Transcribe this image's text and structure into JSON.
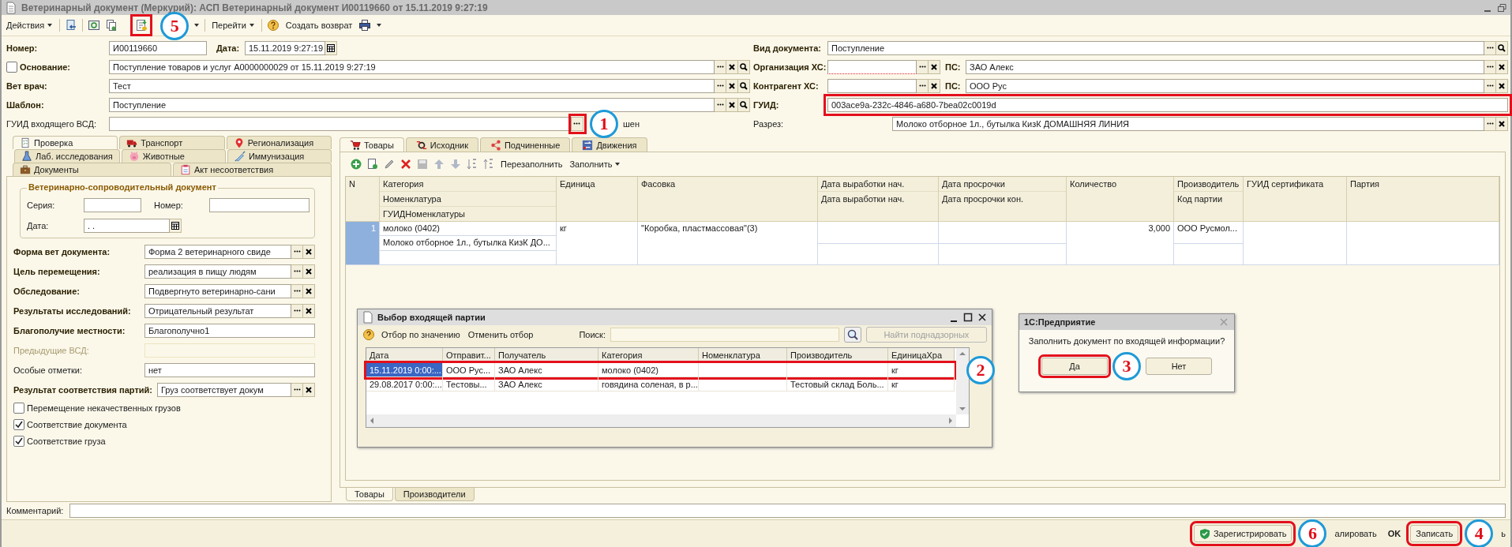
{
  "window": {
    "title": "Ветеринарный документ (Меркурий): АСП Ветеринарный документ И00119660 от 15.11.2019 9:27:19"
  },
  "toolbar": {
    "actions_menu": "Действия",
    "fill_highlighted": true,
    "goto_menu": "Перейти",
    "create_return": "Создать возврат"
  },
  "header_left": [
    {
      "kind": "number_date",
      "label": "Номер:",
      "value": "И00119660",
      "date_label": "Дата:",
      "date_value": "15.11.2019  9:27:19"
    },
    {
      "kind": "check_field",
      "checked": false,
      "label": "Основание:",
      "bold": true,
      "value": "Поступление товаров и услуг А0000000029 от 15.11.2019 9:27:19",
      "buttons": [
        {
          "kind": "select",
          "highlighted": false
        },
        {
          "kind": "clear",
          "highlighted": false
        },
        {
          "kind": "open",
          "highlighted": false
        }
      ]
    },
    {
      "kind": "field",
      "label": "Вет врач:",
      "bold": true,
      "value": "Тест",
      "buttons": [
        {
          "kind": "select",
          "highlighted": false
        },
        {
          "kind": "clear",
          "highlighted": false
        },
        {
          "kind": "open",
          "highlighted": false
        }
      ]
    },
    {
      "kind": "field",
      "label": "Шаблон:",
      "bold": true,
      "value": "Поступление",
      "buttons": [
        {
          "kind": "select",
          "highlighted": false
        },
        {
          "kind": "clear",
          "highlighted": false
        },
        {
          "kind": "open",
          "highlighted": false
        }
      ]
    },
    {
      "kind": "field",
      "label": "ГУИД входящего ВСД:",
      "bold": false,
      "buttons": [
        {
          "kind": "select",
          "highlighted": true
        }
      ],
      "tail": "шен"
    }
  ],
  "header_right": [
    {
      "kind": "field",
      "label": "Вид документа:",
      "bold": true,
      "highlighted": false,
      "value": "Поступление",
      "buttons": [
        {
          "kind": "select",
          "highlighted": false
        },
        {
          "kind": "open",
          "highlighted": false
        }
      ]
    },
    {
      "kind": "pair",
      "label": "Организация ХС:",
      "bold": true,
      "invalid": true,
      "buttons": [
        {
          "kind": "select",
          "highlighted": false
        },
        {
          "kind": "clear",
          "highlighted": false
        }
      ],
      "label2": "ПС:",
      "value2": "ЗАО Алекс",
      "buttons2": [
        {
          "kind": "select",
          "highlighted": false
        },
        {
          "kind": "clear",
          "highlighted": false
        }
      ]
    },
    {
      "kind": "pair",
      "label": "Контрагент ХС:",
      "bold": true,
      "invalid": false,
      "buttons": [
        {
          "kind": "select",
          "highlighted": false
        },
        {
          "kind": "clear",
          "highlighted": false
        }
      ],
      "label2": "ПС:",
      "value2": "ООО Рус",
      "buttons2": [
        {
          "kind": "select",
          "highlighted": false
        },
        {
          "kind": "clear",
          "highlighted": false
        }
      ]
    },
    {
      "kind": "field",
      "label": "ГУИД:",
      "bold": true,
      "highlighted": true,
      "value": "003ace9a-232c-4846-a680-7bea02c0019d"
    },
    {
      "kind": "wide_label_field",
      "label": "Разрез:",
      "bold": false,
      "highlighted": false,
      "value": "Молоко отборное 1л., бутылка КизК ДОМАШНЯЯ ЛИНИЯ",
      "buttons": [
        {
          "kind": "select",
          "highlighted": false
        },
        {
          "kind": "clear",
          "highlighted": false
        }
      ]
    }
  ],
  "left_tabs": [
    [
      {
        "label": "Проверка",
        "selected": true
      },
      {
        "label": "Транспорт",
        "selected": false
      },
      {
        "label": "Регионализация",
        "selected": false
      }
    ],
    [
      {
        "label": "Лаб. исследования",
        "selected": false
      },
      {
        "label": "Животные",
        "selected": false
      },
      {
        "label": "Иммунизация",
        "selected": false
      }
    ],
    [
      {
        "label": "Документы",
        "selected": false
      },
      {
        "label": "Акт несоответствия",
        "selected": false
      }
    ]
  ],
  "vsd_group": {
    "title": "Ветеринарно-сопроводительный документ",
    "series_label": "Серия:",
    "number_label": "Номер:",
    "date_label": "Дата:",
    "date_value": " .  ."
  },
  "left_fields": [
    {
      "label": "Форма вет документа:",
      "bold": true,
      "disabled": false,
      "value": "Форма 2 ветеринарного свиде",
      "buttons": [
        {
          "kind": "select",
          "highlighted": false
        },
        {
          "kind": "clear",
          "highlighted": false
        }
      ]
    },
    {
      "label": "Цель перемещения:",
      "bold": true,
      "disabled": false,
      "value": "реализация в пищу людям",
      "buttons": [
        {
          "kind": "select",
          "highlighted": false
        },
        {
          "kind": "clear",
          "highlighted": false
        }
      ]
    },
    {
      "label": "Обследование:",
      "bold": true,
      "disabled": false,
      "value": "Подвергнуто ветеринарно-сани",
      "buttons": [
        {
          "kind": "select",
          "highlighted": false
        },
        {
          "kind": "clear",
          "highlighted": false
        }
      ]
    },
    {
      "label": "Результаты исследований:",
      "bold": true,
      "disabled": false,
      "value": "Отрицательный результат",
      "buttons": [
        {
          "kind": "select",
          "highlighted": false
        },
        {
          "kind": "clear",
          "highlighted": false
        }
      ]
    },
    {
      "label": "Благополучие местности:",
      "bold": true,
      "disabled": false,
      "value": "Благополучно1"
    },
    {
      "label": "Предыдущие ВСД:",
      "bold": false,
      "disabled": true
    },
    {
      "label": "Особые отметки:",
      "bold": false,
      "disabled": false,
      "value": "нет"
    },
    {
      "label": "Результат соответствия партий:",
      "bold": true,
      "disabled": false,
      "value": "Груз соответствует докум",
      "buttons": [
        {
          "kind": "select",
          "highlighted": false
        },
        {
          "kind": "clear",
          "highlighted": false
        }
      ]
    }
  ],
  "checkboxes": [
    {
      "label": "Перемещение некачественных грузов",
      "checked": false
    },
    {
      "label": "Соответствие документа",
      "checked": true
    },
    {
      "label": "Соответствие груза",
      "checked": true
    }
  ],
  "right_tabs": [
    {
      "label": "Товары",
      "selected": true
    },
    {
      "label": "Исходник",
      "selected": false
    },
    {
      "label": "Подчиненные",
      "selected": false
    },
    {
      "label": "Движения",
      "selected": false
    }
  ],
  "grid_toolbar": {
    "refill": "Перезаполнить",
    "fill": "Заполнить"
  },
  "table": {
    "columns": [
      {
        "headers": [
          "N"
        ]
      },
      {
        "headers": [
          "Категория",
          "Номенклатура",
          "ГУИДНоменклатуры"
        ]
      },
      {
        "headers": [
          "Единица"
        ]
      },
      {
        "headers": [
          "Фасовка"
        ]
      },
      {
        "headers": [
          "Дата выработки нач.",
          "Дата выработки нач."
        ]
      },
      {
        "headers": [
          "Дата просрочки",
          "Дата просрочки кон."
        ]
      },
      {
        "headers": [
          "Количество"
        ]
      },
      {
        "headers": [
          "Производитель",
          "Код партии"
        ]
      },
      {
        "headers": [
          "ГУИД сертификата"
        ]
      },
      {
        "headers": [
          "Партия"
        ]
      }
    ],
    "rows": [
      {
        "cells": [
          [
            "1"
          ],
          [
            "молоко (0402)",
            "Молоко отборное 1л., бутылка КизК ДО..."
          ],
          [
            "кг"
          ],
          [
            "\"Коробка, пластмассовая\"(3)"
          ],
          null,
          null,
          [
            "3,000"
          ],
          [
            "ООО Русмол..."
          ],
          null,
          null
        ]
      }
    ]
  },
  "bottom_tabs": [
    {
      "label": "Товары",
      "selected": true
    },
    {
      "label": "Производители",
      "selected": false
    }
  ],
  "comment": {
    "label": "Комментарий:"
  },
  "footer": [
    {
      "kind": "register",
      "label": "Зарегистрировать",
      "highlighted": true
    },
    {
      "kind": "text",
      "label": "алировать"
    },
    {
      "kind": "ok",
      "label": "OK"
    },
    {
      "kind": "button",
      "label": "Записать",
      "highlighted": true
    },
    {
      "kind": "text",
      "label": "ь"
    }
  ],
  "selection_dialog": {
    "title": "Выбор входящей партии",
    "filter": "Отбор по значению",
    "cancel_filter": "Отменить отбор",
    "search_label": "Поиск:",
    "find_button": {
      "label": "Найти поднадзорных",
      "disabled": true
    },
    "columns": [
      "Дата",
      "Отправит...",
      "Получатель",
      "Категория",
      "Номенклатура",
      "Производитель",
      "ЕдиницаХра"
    ],
    "rows": [
      {
        "selected": true,
        "highlighted": true,
        "cells": [
          "15.11.2019 0:00:...",
          "ООО Рус...",
          "ЗАО Алекс",
          "молоко (0402)",
          null,
          null,
          "кг"
        ]
      },
      {
        "selected": false,
        "highlighted": false,
        "cells": [
          "29.08.2017 0:00:...",
          "Тестовы...",
          "ЗАО Алекс",
          "говядина соленая, в р...",
          null,
          "Тестовый склад Боль...",
          "кг"
        ]
      }
    ]
  },
  "confirm_dialog": {
    "title": "1С:Предприятие",
    "question": "Заполнить документ по входящей информации?",
    "buttons": [
      {
        "label": "Да",
        "highlighted": true
      },
      {
        "label": "Нет",
        "highlighted": false
      }
    ]
  },
  "annotations": [
    {
      "number": "5"
    },
    {
      "number": "1"
    },
    {
      "number": "2"
    },
    {
      "number": "3"
    },
    {
      "number": "6"
    },
    {
      "number": "4"
    }
  ]
}
